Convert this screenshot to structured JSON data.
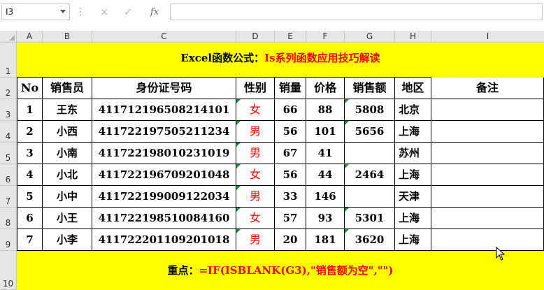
{
  "formula_bar": {
    "name_box": "I3",
    "cancel_icon": "×",
    "enter_icon": "✓",
    "fx_label": "fx",
    "formula": ""
  },
  "columns": [
    "A",
    "B",
    "C",
    "D",
    "E",
    "F",
    "G",
    "H",
    "I"
  ],
  "rows": [
    "1",
    "2",
    "3",
    "4",
    "5",
    "6",
    "7",
    "8",
    "9",
    "10"
  ],
  "title": {
    "part1": "Excel函数公式：",
    "part2": "Is系列函数应用技巧解读"
  },
  "headers": [
    "No",
    "销售员",
    "身份证号码",
    "性别",
    "销量",
    "价格",
    "销售额",
    "地区",
    "备注"
  ],
  "table": [
    {
      "no": "1",
      "name": "王东",
      "id": "411712196508214101",
      "gender": "女",
      "qty": "66",
      "price": "88",
      "sales": "5808",
      "region": "北京",
      "note": ""
    },
    {
      "no": "2",
      "name": "小西",
      "id": "411722197505211234",
      "gender": "男",
      "qty": "56",
      "price": "101",
      "sales": "5656",
      "region": "上海",
      "note": ""
    },
    {
      "no": "3",
      "name": "小南",
      "id": "411722198010231019",
      "gender": "男",
      "qty": "67",
      "price": "41",
      "sales": "",
      "region": "苏州",
      "note": ""
    },
    {
      "no": "4",
      "name": "小北",
      "id": "411722196709201048",
      "gender": "女",
      "qty": "56",
      "price": "44",
      "sales": "2464",
      "region": "上海",
      "note": ""
    },
    {
      "no": "5",
      "name": "小中",
      "id": "411722199009122034",
      "gender": "男",
      "qty": "33",
      "price": "146",
      "sales": "",
      "region": "天津",
      "note": ""
    },
    {
      "no": "6",
      "name": "小王",
      "id": "411722198510084160",
      "gender": "女",
      "qty": "57",
      "price": "93",
      "sales": "5301",
      "region": "上海",
      "note": ""
    },
    {
      "no": "7",
      "name": "小李",
      "id": "411722201109201018",
      "gender": "男",
      "qty": "20",
      "price": "181",
      "sales": "3620",
      "region": "上海",
      "note": ""
    }
  ],
  "note": {
    "part1": "重点：",
    "part2": "=IF(ISBLANK(G3),\"销售额为空\",\"\")"
  },
  "colors": {
    "highlight": "#ffff00",
    "accent": "#ff0000",
    "header_bg": "#e6e6e6",
    "error_marker": "#1e8a3e"
  }
}
